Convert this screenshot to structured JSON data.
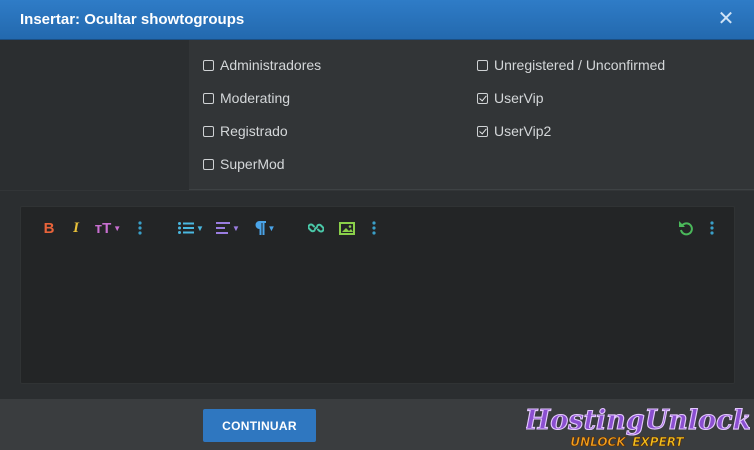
{
  "dialog": {
    "title": "Insertar: Ocultar showtogroups",
    "close_glyph": "✕"
  },
  "groups": {
    "left_column": [
      {
        "label": "Administradores",
        "checked": false
      },
      {
        "label": "Moderating",
        "checked": false
      },
      {
        "label": "Registrado",
        "checked": false
      },
      {
        "label": "SuperMod",
        "checked": false
      }
    ],
    "right_column": [
      {
        "label": "Unregistered / Unconfirmed",
        "checked": false
      },
      {
        "label": "UserVip",
        "checked": true
      },
      {
        "label": "UserVip2",
        "checked": true
      }
    ]
  },
  "toolbar": {
    "bold": "B",
    "italic": "I",
    "text_size": "тT",
    "icons": [
      "bold-icon",
      "italic-icon",
      "text-size-icon",
      "more-vertical-icon",
      "list-icon",
      "align-icon",
      "paragraph-icon",
      "link-icon",
      "image-icon",
      "more-vertical-icon",
      "undo-icon",
      "more-vertical-icon"
    ],
    "colors": {
      "bold": "#e8633a",
      "italic": "#e8c13a",
      "text_size": "#c86fd0",
      "more": "#3a9fc8",
      "list": "#4ab8e0",
      "align": "#9a7de0",
      "paragraph": "#4aa4e8",
      "link": "#4ac8a8",
      "image": "#8ad04a",
      "undo": "#4ab85a"
    }
  },
  "footer": {
    "continue_label": "CONTINUAR"
  },
  "watermark": {
    "line1": "HostingUnlock",
    "line2_left": "UNLOCK",
    "line2_right": "EXPERT"
  }
}
